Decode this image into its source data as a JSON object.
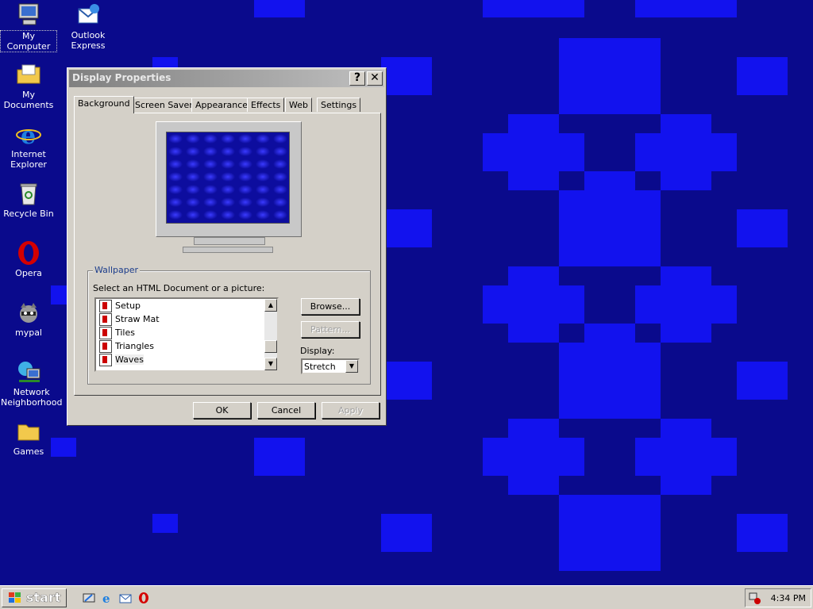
{
  "desktop_icons": [
    {
      "name": "my-computer",
      "label": "My Computer",
      "selected": true
    },
    {
      "name": "outlook-express",
      "label": "Outlook Express"
    },
    {
      "name": "my-documents",
      "label": "My Documents"
    },
    {
      "name": "internet-explorer",
      "label": "Internet Explorer"
    },
    {
      "name": "recycle-bin",
      "label": "Recycle Bin"
    },
    {
      "name": "opera",
      "label": "Opera"
    },
    {
      "name": "mypal",
      "label": "mypal"
    },
    {
      "name": "network-neighborhood",
      "label": "Network Neighborhood"
    },
    {
      "name": "games",
      "label": "Games"
    }
  ],
  "dialog": {
    "title": "Display Properties",
    "help_button": "?",
    "close_button": "✕",
    "tabs": [
      "Background",
      "Screen Saver",
      "Appearance",
      "Effects",
      "Web",
      "Settings"
    ],
    "active_tab": "Background",
    "wallpaper_group": "Wallpaper",
    "select_label": "Select an HTML Document or a picture:",
    "wallpaper_list": [
      "Setup",
      "Straw Mat",
      "Tiles",
      "Triangles",
      "Waves"
    ],
    "selected_wallpaper": "Waves",
    "browse_button": "Browse...",
    "pattern_button": "Pattern...",
    "display_label": "Display:",
    "display_value": "Stretch",
    "ok_button": "OK",
    "cancel_button": "Cancel",
    "apply_button": "Apply"
  },
  "taskbar": {
    "start_label": "start",
    "quicklaunch": [
      "show-desktop-icon",
      "ie-icon",
      "outlook-icon",
      "opera-icon"
    ],
    "clock": "4:34 PM"
  },
  "colors": {
    "desktop_bg": "#0a0a8c",
    "pattern": "#1212ee",
    "dialog_bg": "#d4d0c8"
  }
}
